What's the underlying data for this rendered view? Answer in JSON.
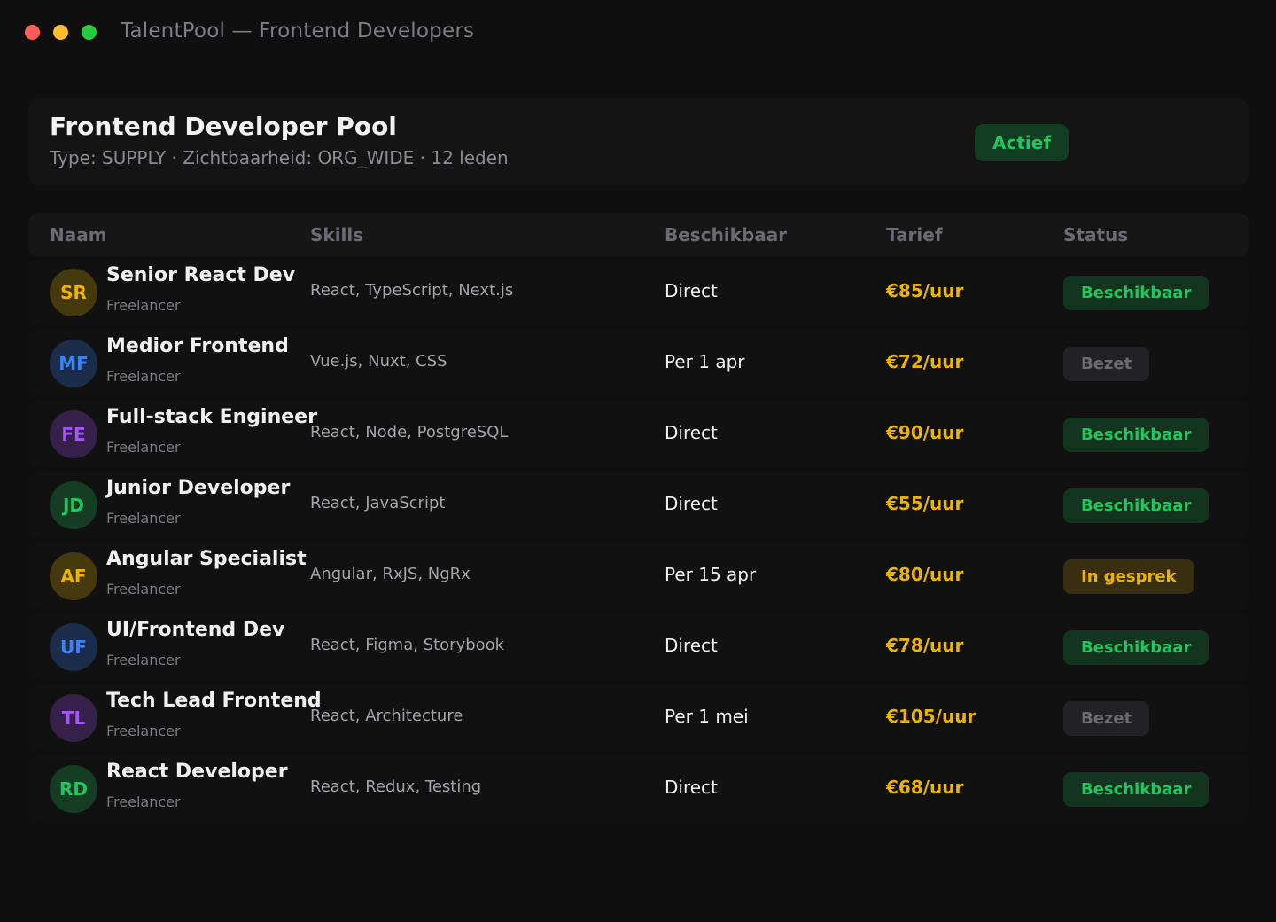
{
  "window": {
    "title": "TalentPool — Frontend Developers"
  },
  "pool": {
    "title": "Frontend Developer Pool",
    "meta": "Type: SUPPLY · Zichtbaarheid: ORG_WIDE · 12 leden",
    "badge": "Actief"
  },
  "table": {
    "headers": {
      "name": "Naam",
      "skills": "Skills",
      "available": "Beschikbaar",
      "rate": "Tarief",
      "status": "Status"
    },
    "rows": [
      {
        "initials": "SR",
        "name": "Senior React Dev",
        "role": "Freelancer",
        "skills": "React, TypeScript, Next.js",
        "available": "Direct",
        "rate": "€85/uur",
        "status": "Beschikbaar",
        "status_kind": "green",
        "avatar_color": "#eab308"
      },
      {
        "initials": "MF",
        "name": "Medior Frontend",
        "role": "Freelancer",
        "skills": "Vue.js, Nuxt, CSS",
        "available": "Per 1 apr",
        "rate": "€72/uur",
        "status": "Bezet",
        "status_kind": "gray",
        "avatar_color": "#3b82f6"
      },
      {
        "initials": "FE",
        "name": "Full-stack Engineer",
        "role": "Freelancer",
        "skills": "React, Node, PostgreSQL",
        "available": "Direct",
        "rate": "€90/uur",
        "status": "Beschikbaar",
        "status_kind": "green",
        "avatar_color": "#a855f7"
      },
      {
        "initials": "JD",
        "name": "Junior Developer",
        "role": "Freelancer",
        "skills": "React, JavaScript",
        "available": "Direct",
        "rate": "€55/uur",
        "status": "Beschikbaar",
        "status_kind": "green",
        "avatar_color": "#22c55e"
      },
      {
        "initials": "AF",
        "name": "Angular Specialist",
        "role": "Freelancer",
        "skills": "Angular, RxJS, NgRx",
        "available": "Per 15 apr",
        "rate": "€80/uur",
        "status": "In gesprek",
        "status_kind": "yellow",
        "avatar_color": "#eab308"
      },
      {
        "initials": "UF",
        "name": "UI/Frontend Dev",
        "role": "Freelancer",
        "skills": "React, Figma, Storybook",
        "available": "Direct",
        "rate": "€78/uur",
        "status": "Beschikbaar",
        "status_kind": "green",
        "avatar_color": "#3b82f6"
      },
      {
        "initials": "TL",
        "name": "Tech Lead Frontend",
        "role": "Freelancer",
        "skills": "React, Architecture",
        "available": "Per 1 mei",
        "rate": "€105/uur",
        "status": "Bezet",
        "status_kind": "gray",
        "avatar_color": "#a855f7"
      },
      {
        "initials": "RD",
        "name": "React Developer",
        "role": "Freelancer",
        "skills": "React, Redux, Testing",
        "available": "Direct",
        "rate": "€68/uur",
        "status": "Beschikbaar",
        "status_kind": "green",
        "avatar_color": "#22c55e"
      }
    ]
  },
  "colors": {
    "background": "#0f0f0f",
    "accent_green": "#22c55e",
    "accent_yellow": "#eab308",
    "muted": "#6b6b73"
  }
}
